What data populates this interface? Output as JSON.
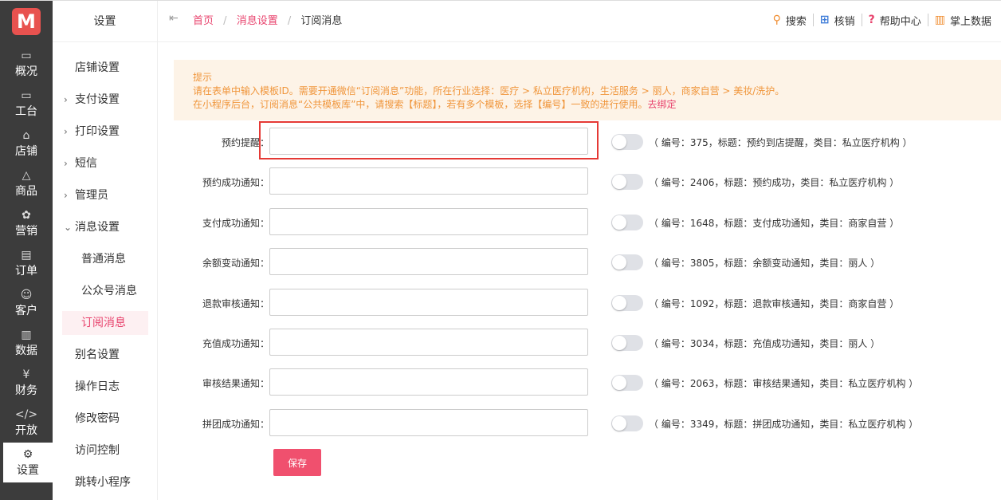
{
  "rail": {
    "logo": "M",
    "items": [
      {
        "label": "概况",
        "icon": "monitor-icon",
        "glyph": "▭"
      },
      {
        "label": "工台",
        "icon": "desktop-icon",
        "glyph": "▭"
      },
      {
        "label": "店铺",
        "icon": "store-icon",
        "glyph": "⌂"
      },
      {
        "label": "商品",
        "icon": "bag-icon",
        "glyph": "△"
      },
      {
        "label": "营销",
        "icon": "flower-icon",
        "glyph": "✿"
      },
      {
        "label": "订单",
        "icon": "order-icon",
        "glyph": "▤"
      },
      {
        "label": "客户",
        "icon": "user-icon",
        "glyph": "☺"
      },
      {
        "label": "数据",
        "icon": "chart-icon",
        "glyph": "▥"
      },
      {
        "label": "财务",
        "icon": "finance-icon",
        "glyph": "¥"
      },
      {
        "label": "开放",
        "icon": "code-icon",
        "glyph": "</>"
      },
      {
        "label": "设置",
        "icon": "settings-icon",
        "glyph": "⚙"
      }
    ]
  },
  "sub": {
    "title": "设置",
    "items": [
      {
        "label": "店铺设置",
        "caret": ""
      },
      {
        "label": "支付设置",
        "caret": "›"
      },
      {
        "label": "打印设置",
        "caret": "›"
      },
      {
        "label": "短信",
        "caret": "›"
      },
      {
        "label": "管理员",
        "caret": "›"
      },
      {
        "label": "消息设置",
        "caret": "⌄"
      }
    ],
    "children": [
      {
        "label": "普通消息"
      },
      {
        "label": "公众号消息"
      },
      {
        "label": "订阅消息"
      }
    ],
    "items_after": [
      {
        "label": "别名设置"
      },
      {
        "label": "操作日志"
      },
      {
        "label": "修改密码"
      },
      {
        "label": "访问控制"
      },
      {
        "label": "跳转小程序"
      }
    ]
  },
  "header": {
    "breadcrumb": [
      "首页",
      "消息设置",
      "订阅消息"
    ],
    "separator": "/",
    "tools": [
      {
        "label": "搜索",
        "icon": "search-icon",
        "glyph": "⚲",
        "color": "#f08c2e"
      },
      {
        "label": "核销",
        "icon": "scan-icon",
        "glyph": "⊞",
        "color": "#3d7bd8"
      },
      {
        "label": "帮助中心",
        "icon": "help-icon",
        "glyph": "?",
        "color": "#e8436d"
      },
      {
        "label": "掌上数据",
        "icon": "data-icon",
        "glyph": "▥",
        "color": "#f08c2e"
      }
    ]
  },
  "tip": {
    "title": "提示",
    "line1": "请在表单中输入模板ID。需要开通微信“订阅消息”功能，所在行业选择：医疗 > 私立医疗机构，生活服务 > 丽人，商家自营 > 美妆/洗护。",
    "line2": "在小程序后台，订阅消息“公共模板库”中，请搜索【标题】，若有多个模板，选择【编号】一致的进行使用。",
    "link": "去绑定"
  },
  "form": {
    "rows": [
      {
        "label": "预约提醒：",
        "value": "",
        "note": "（ 编号：375，标题：预约到店提醒，类目：私立医疗机构 ）",
        "enabled": false
      },
      {
        "label": "预约成功通知：",
        "value": "",
        "note": "（ 编号：2406，标题：预约成功，类目：私立医疗机构 ）",
        "enabled": false
      },
      {
        "label": "支付成功通知：",
        "value": "",
        "note": "（ 编号：1648，标题：支付成功通知，类目：商家自营 ）",
        "enabled": false
      },
      {
        "label": "余额变动通知：",
        "value": "",
        "note": "（ 编号：3805，标题：余额变动通知，类目：丽人 ）",
        "enabled": false
      },
      {
        "label": "退款审核通知：",
        "value": "",
        "note": "（ 编号：1092，标题：退款审核通知，类目：商家自营 ）",
        "enabled": false
      },
      {
        "label": "充值成功通知：",
        "value": "",
        "note": "（ 编号：3034，标题：充值成功通知，类目：丽人 ）",
        "enabled": false
      },
      {
        "label": "审核结果通知：",
        "value": "",
        "note": "（ 编号：2063，标题：审核结果通知，类目：私立医疗机构 ）",
        "enabled": false
      },
      {
        "label": "拼团成功通知：",
        "value": "",
        "note": "（ 编号：3349，标题：拼团成功通知，类目：私立医疗机构 ）",
        "enabled": false
      }
    ],
    "save_label": "保存"
  },
  "colors": {
    "accent": "#e8436d",
    "save": "#f0506e",
    "highlight": "#e53935",
    "tip_text": "#f0963c"
  }
}
